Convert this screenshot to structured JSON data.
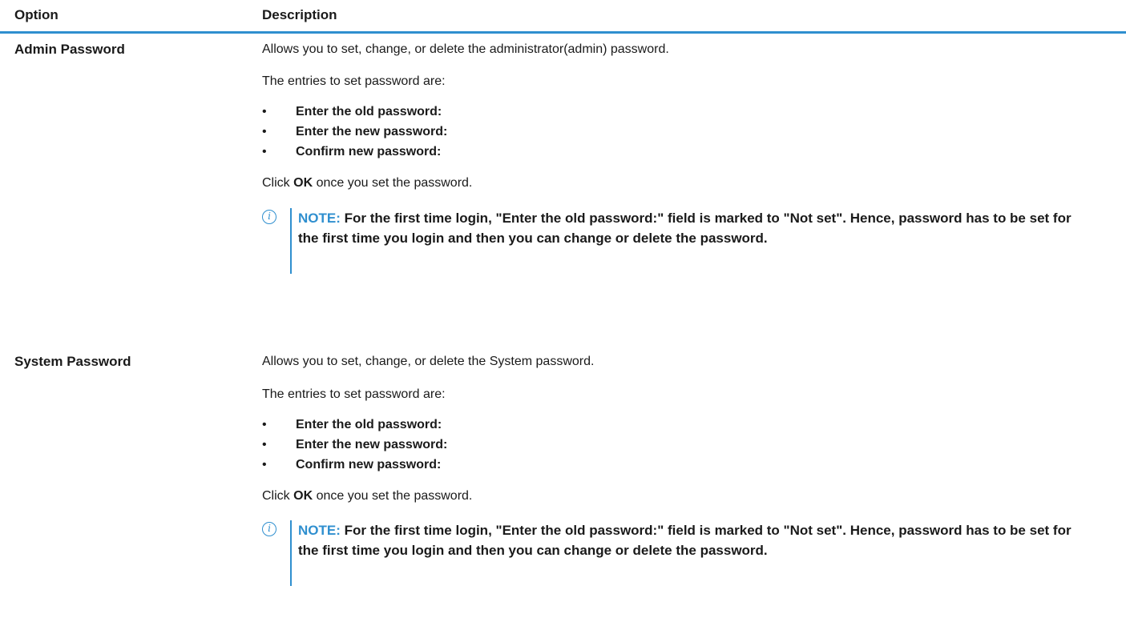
{
  "header": {
    "option": "Option",
    "description": "Description"
  },
  "rows": [
    {
      "name": "Admin Password",
      "intro": "Allows you to set, change, or delete the administrator(admin) password.",
      "entries_heading": "The entries to set password are:",
      "bullets": [
        "Enter the old password:",
        "Enter the new password:",
        "Confirm new password:"
      ],
      "click_prefix": "Click",
      "click_bold": "OK",
      "click_suffix": "once you set the password.",
      "note_label": "NOTE:",
      "note_text": "For the first time login, \"Enter the old password:\" field is marked to \"Not set\". Hence, password has to be set for the first time you login and then you can change or delete the password."
    },
    {
      "name": "System Password",
      "intro": "Allows you to set, change, or delete the System password.",
      "entries_heading": "The entries to set password are:",
      "bullets": [
        "Enter the old password:",
        "Enter the new password:",
        "Confirm new password:"
      ],
      "click_prefix": "Click",
      "click_bold": "OK",
      "click_suffix": "once you set the password.",
      "note_label": "NOTE:",
      "note_text": "For the first time login, \"Enter the old password:\" field is marked to \"Not set\". Hence, password has to be set for the first time you login and then you can change or delete the password."
    }
  ],
  "icons": {
    "bullet": "•",
    "info": "i"
  },
  "colors": {
    "accent": "#2f8fcf"
  }
}
